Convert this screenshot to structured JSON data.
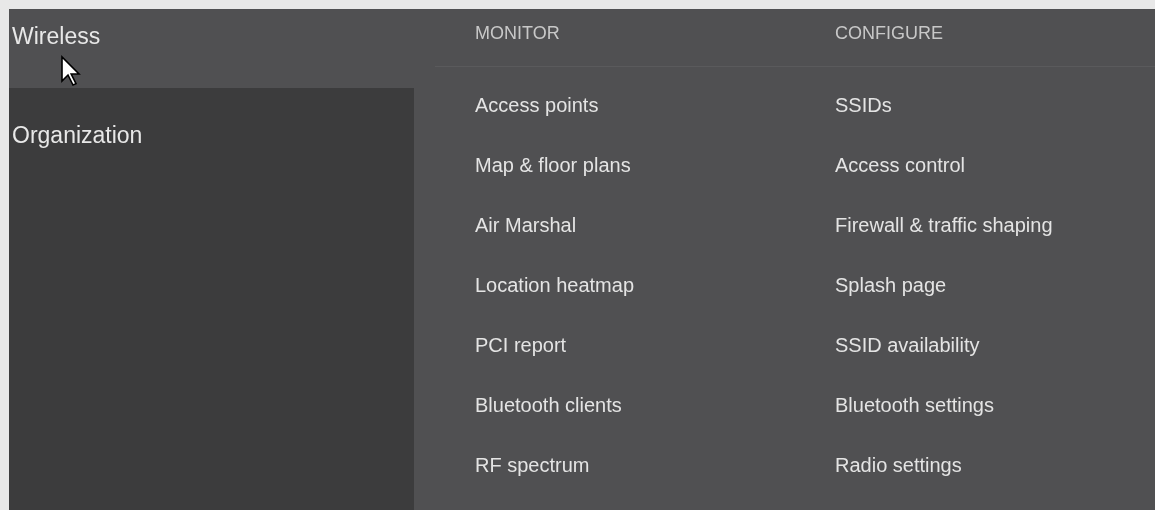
{
  "sidebar": {
    "items": [
      {
        "label": "Wireless",
        "selected": true
      },
      {
        "label": "Organization",
        "selected": false
      }
    ]
  },
  "menu": {
    "columns": [
      {
        "heading": "MONITOR",
        "items": [
          "Access points",
          "Map & floor plans",
          "Air Marshal",
          "Location heatmap",
          "PCI report",
          "Bluetooth clients",
          "RF spectrum"
        ]
      },
      {
        "heading": "CONFIGURE",
        "items": [
          "SSIDs",
          "Access control",
          "Firewall & traffic shaping",
          "Splash page",
          "SSID availability",
          "Bluetooth settings",
          "Radio settings"
        ]
      }
    ]
  }
}
